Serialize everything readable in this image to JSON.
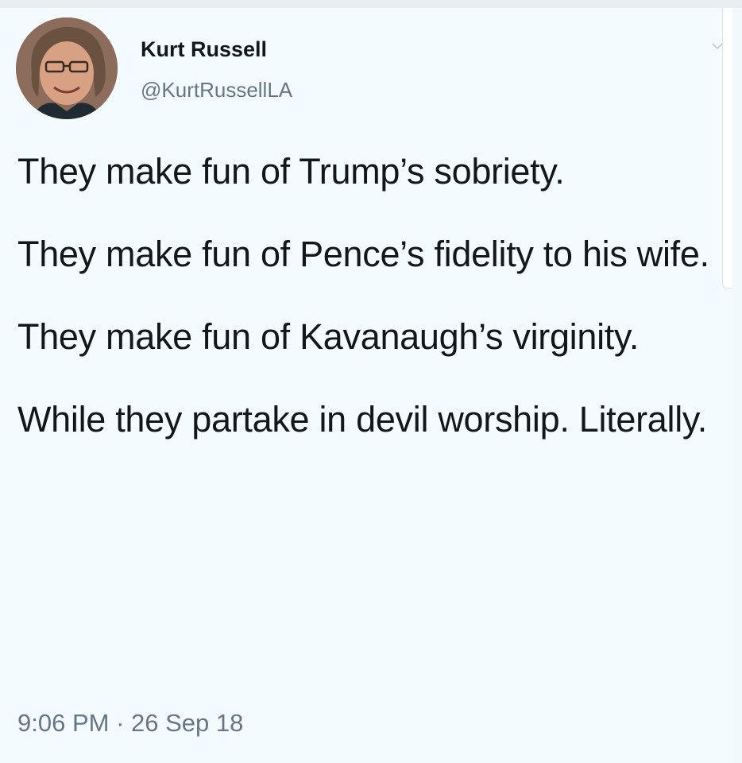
{
  "author": {
    "name": "Kurt Russell",
    "handle": "@KurtRussellLA",
    "avatar_icon": "profile-photo"
  },
  "tweet": {
    "paragraphs": [
      "They make fun of Trump’s sobriety.",
      "They make fun of Pence’s fidelity to his wife.",
      "They make fun of Kavanaugh’s virginity.",
      "While they partake in devil worship. Literally."
    ],
    "time": "9:06 PM",
    "separator": "·",
    "date": "26 Sep 18"
  },
  "menu": {
    "icon": "chevron-down-icon"
  },
  "colors": {
    "background": "#f4fbfe",
    "text": "#14171a",
    "secondary_text": "#657786"
  }
}
